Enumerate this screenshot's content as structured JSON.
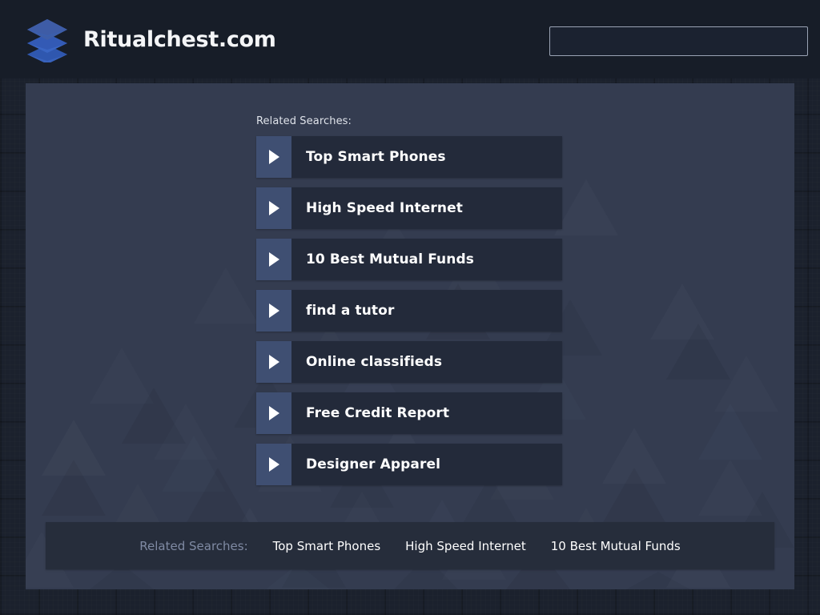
{
  "header": {
    "brand_name": "Ritualchest.com",
    "logo_icon": "stacked-layers-icon",
    "logo_color": "#3c5596",
    "search": {
      "value": "",
      "placeholder": ""
    }
  },
  "main": {
    "results_caption": "Related Searches:",
    "arrow_icon": "play-triangle-icon",
    "results": [
      {
        "label": "Top Smart Phones"
      },
      {
        "label": "High Speed Internet"
      },
      {
        "label": "10 Best Mutual Funds"
      },
      {
        "label": "find a tutor"
      },
      {
        "label": "Online classifieds"
      },
      {
        "label": "Free Credit Report"
      },
      {
        "label": "Designer Apparel"
      }
    ]
  },
  "footer": {
    "caption": "Related Searches:",
    "links": [
      {
        "label": "Top Smart Phones"
      },
      {
        "label": "High Speed Internet"
      },
      {
        "label": "10 Best Mutual Funds"
      }
    ]
  },
  "colors": {
    "page_background": "#1b212d",
    "header_background": "#171d28",
    "panel_background": "#343c50",
    "row_background": "#232a3a",
    "arrow_background": "#3f4f72",
    "footer_background": "#262d3b",
    "accent_text": "#ffffff",
    "muted_text": "#7f8aa3"
  }
}
